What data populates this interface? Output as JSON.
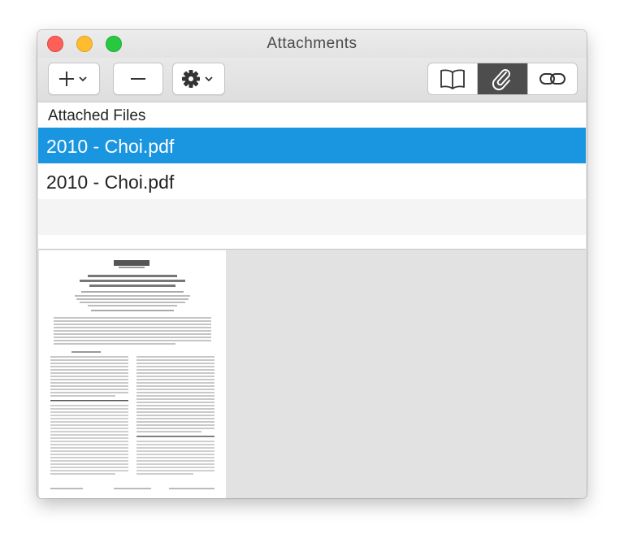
{
  "window": {
    "title": "Attachments"
  },
  "toolbar": {
    "add_icon": "plus-icon",
    "remove_icon": "minus-icon",
    "action_icon": "gear-icon",
    "view_modes": [
      "book-icon",
      "paperclip-icon",
      "link-icon"
    ],
    "active_view_mode": "paperclip-icon"
  },
  "list": {
    "header": "Attached Files",
    "items": [
      {
        "name": "2010 - Choi.pdf",
        "selected": true
      },
      {
        "name": "2010 - Choi.pdf",
        "selected": false
      }
    ]
  },
  "preview": {
    "thumbnail": "pdf-page-thumbnail"
  },
  "colors": {
    "selection": "#1a95e0",
    "active_segment": "#4d4d4d",
    "close": "#fe5f57",
    "minimize": "#febc2e",
    "maximize": "#28c840"
  }
}
